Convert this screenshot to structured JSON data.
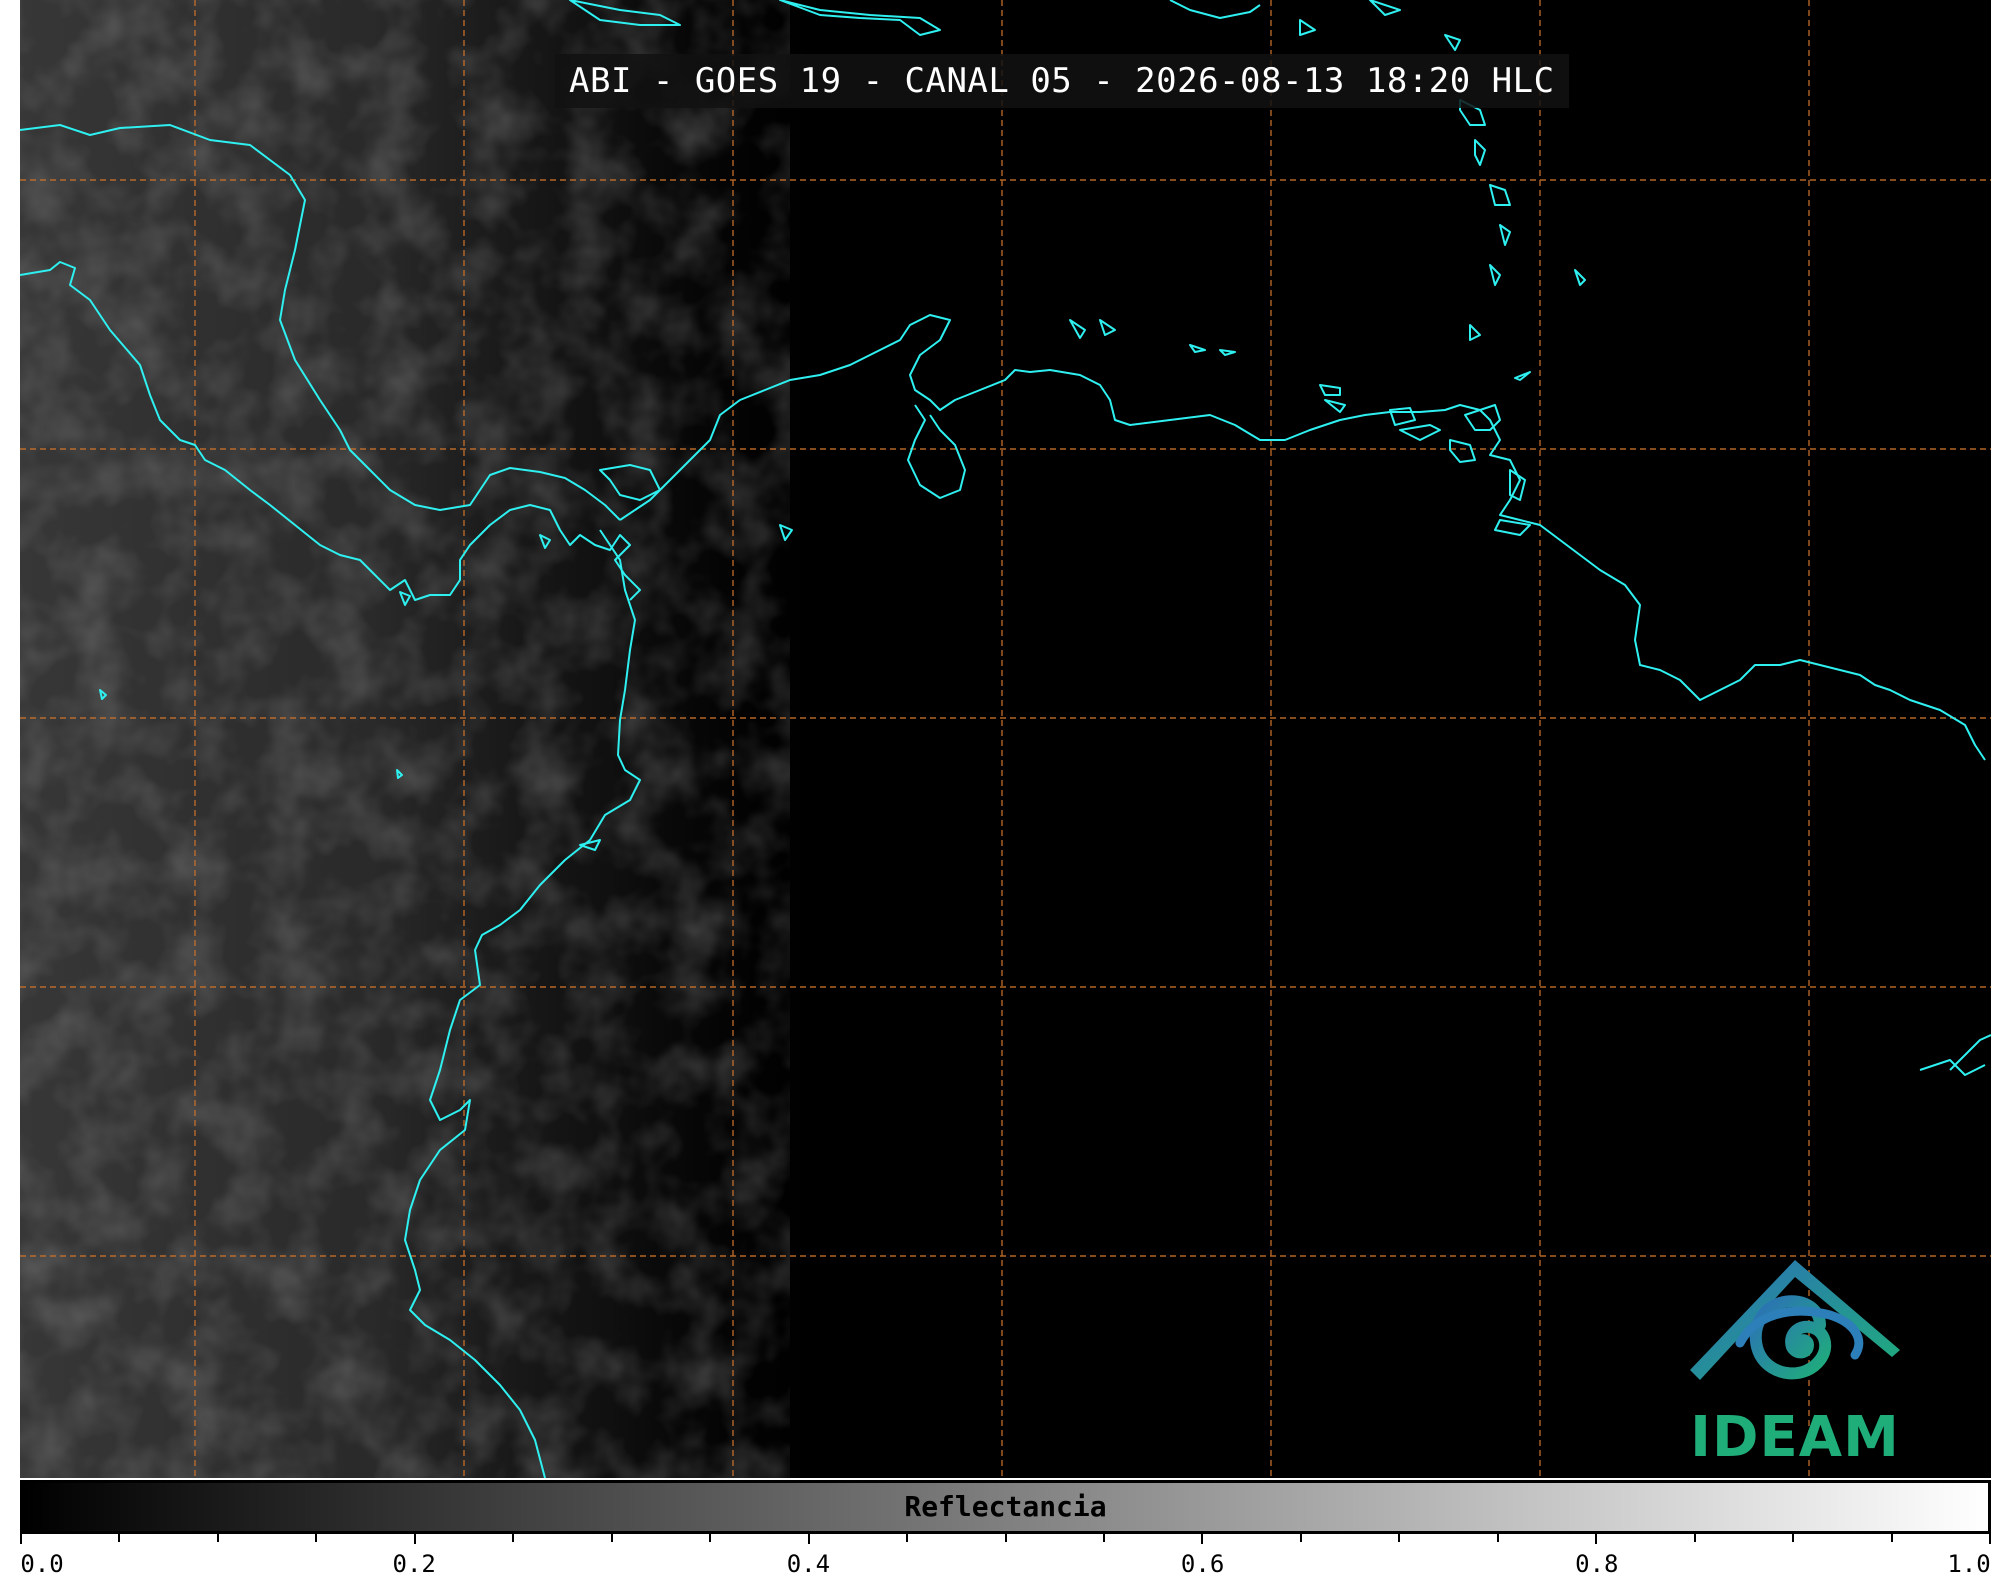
{
  "map": {
    "title": "ABI - GOES 19 - CANAL 05 - 2026-08-13 18:20 HLC",
    "coastline_color": "#2ff0f0",
    "graticule_color": "#c8702a",
    "background_color": "#000000"
  },
  "logo": {
    "text": "IDEAM",
    "colors": [
      "#2c7fb8",
      "#1fae7a"
    ]
  },
  "colorbar": {
    "label": "Reflectancia",
    "min": 0.0,
    "max": 1.0,
    "gradient": [
      "#000000",
      "#ffffff"
    ],
    "tick_labels": [
      "0.0",
      "0.2",
      "0.4",
      "0.6",
      "0.8",
      "1.0"
    ]
  }
}
